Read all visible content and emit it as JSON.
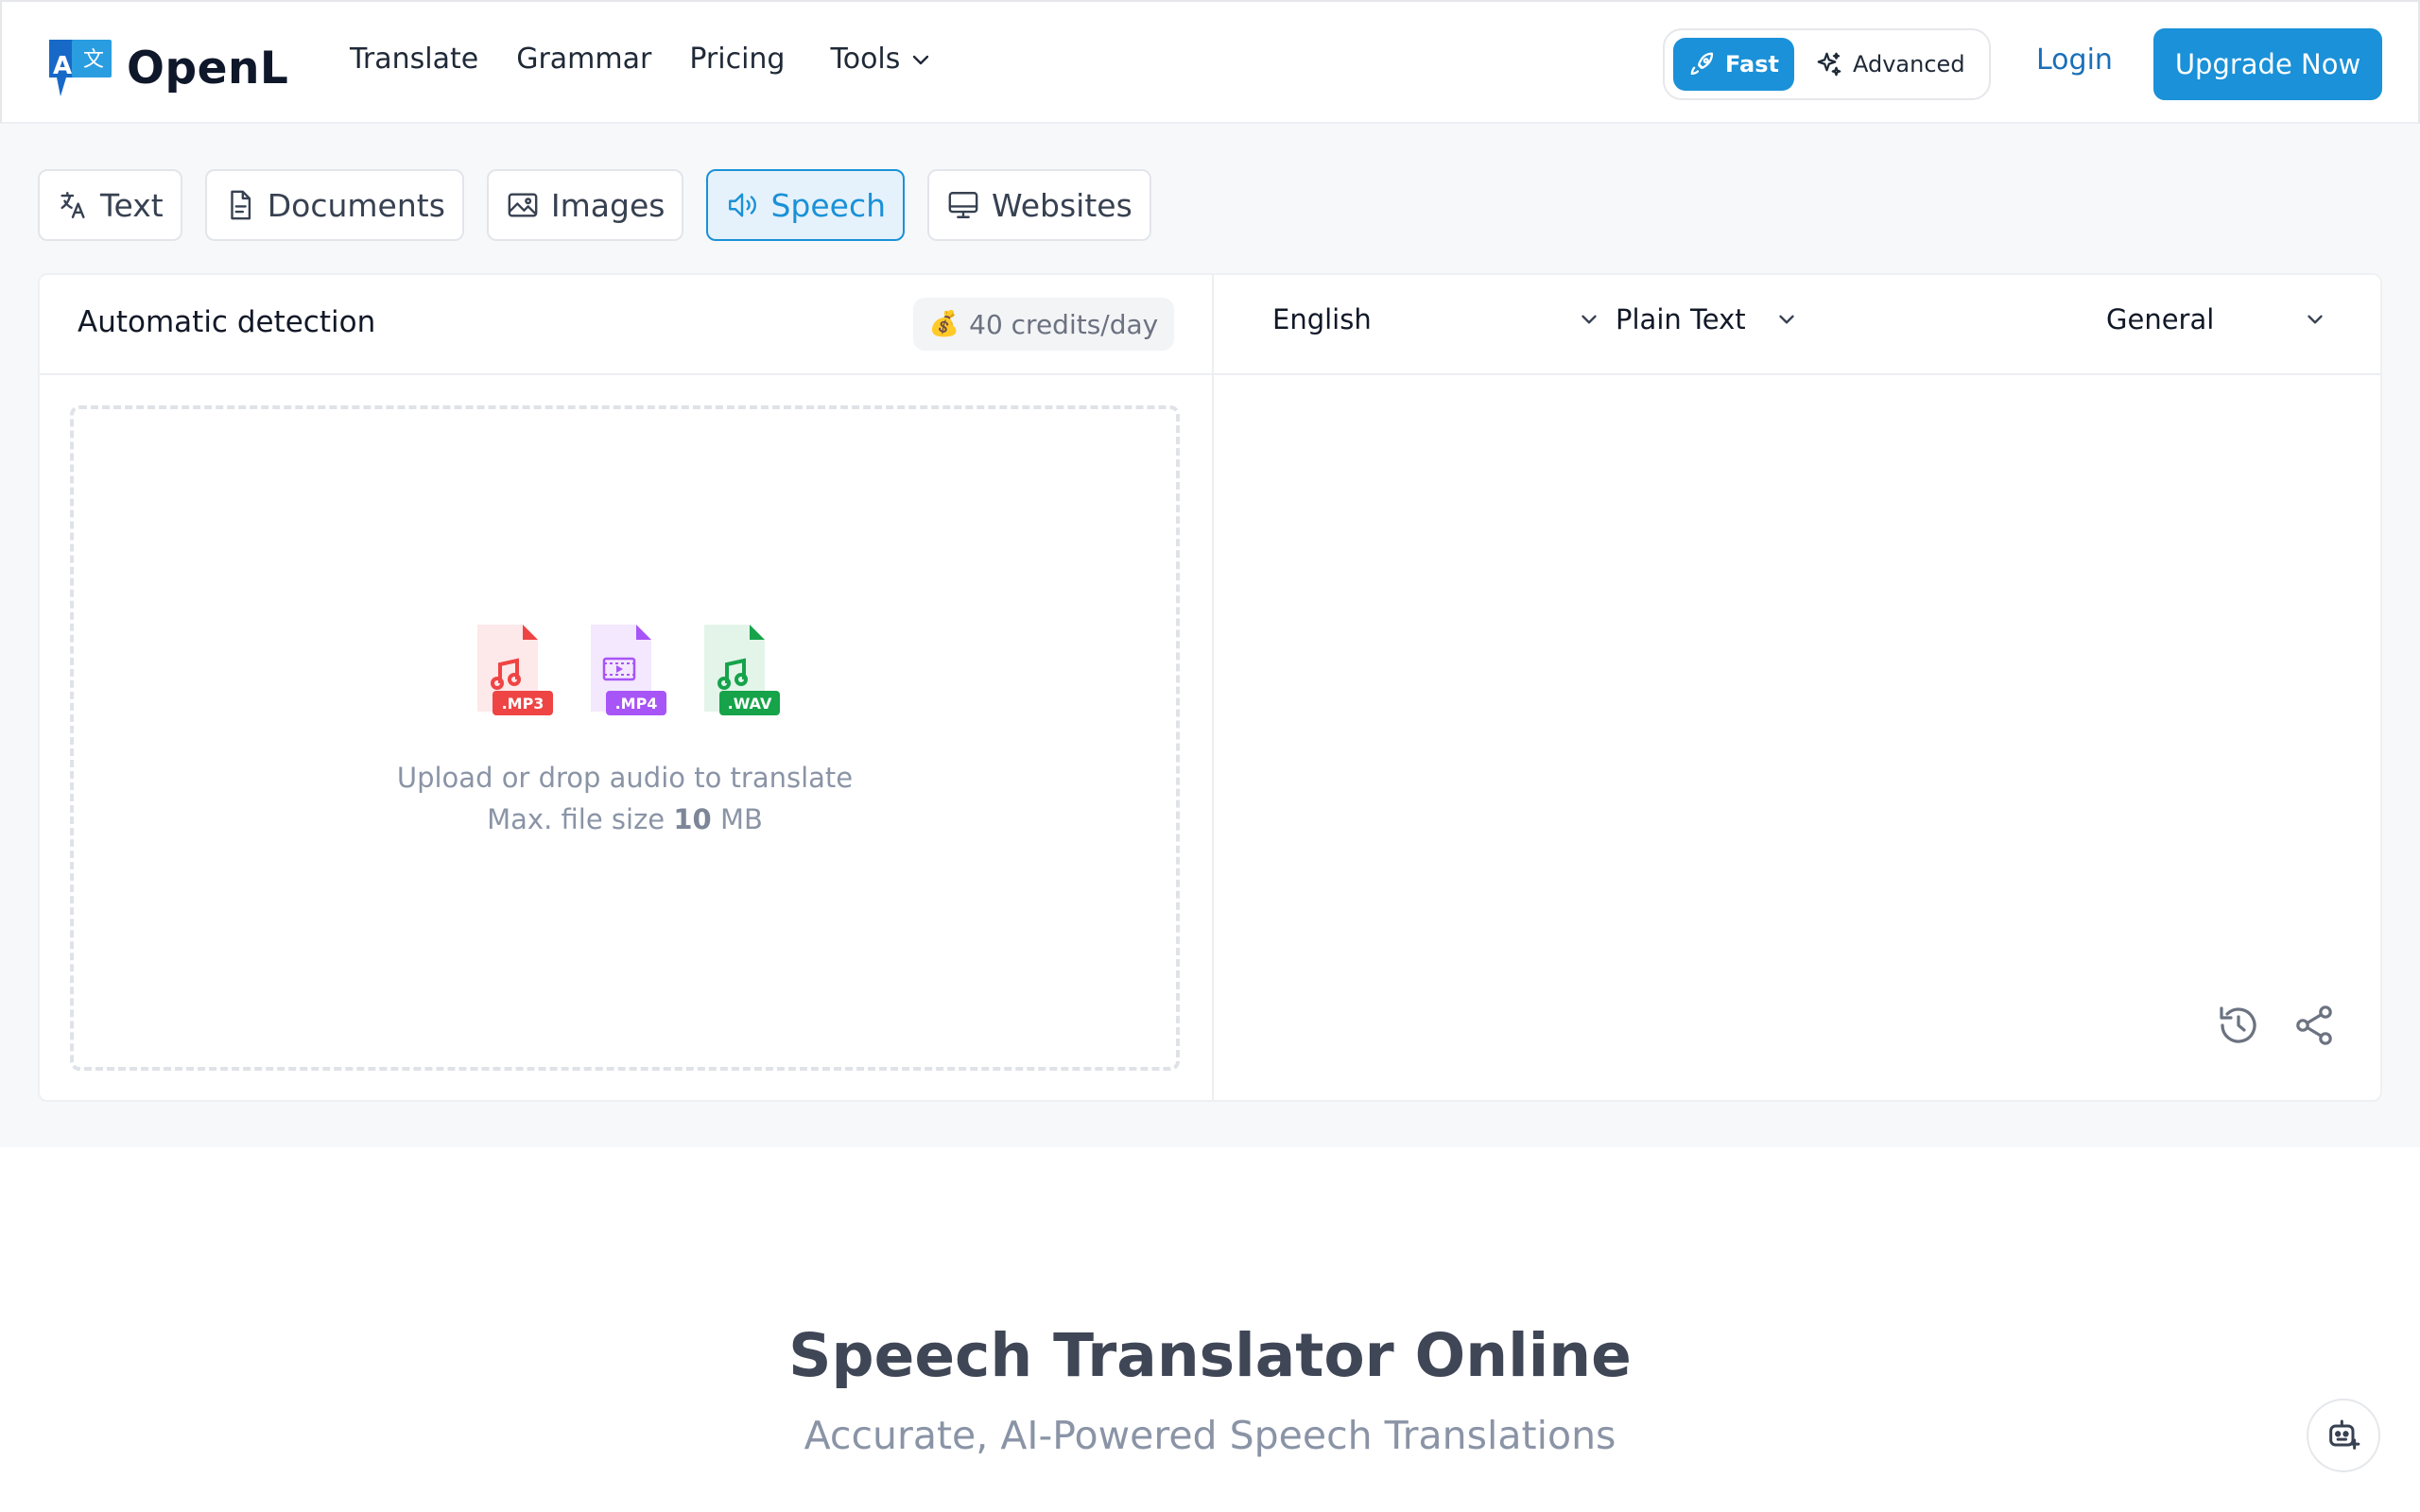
{
  "brand": {
    "name": "OpenL",
    "logo_letters": "A 文"
  },
  "nav": {
    "items": [
      "Translate",
      "Grammar",
      "Pricing"
    ],
    "tools_label": "Tools"
  },
  "mode": {
    "fast_label": "Fast",
    "advanced_label": "Advanced",
    "selected": "Fast"
  },
  "auth": {
    "login_label": "Login",
    "upgrade_label": "Upgrade Now"
  },
  "tabs": [
    {
      "label": "Text",
      "icon": "translate-icon",
      "active": false
    },
    {
      "label": "Documents",
      "icon": "document-icon",
      "active": false
    },
    {
      "label": "Images",
      "icon": "image-icon",
      "active": false
    },
    {
      "label": "Speech",
      "icon": "speaker-icon",
      "active": true
    },
    {
      "label": "Websites",
      "icon": "monitor-icon",
      "active": false
    }
  ],
  "source": {
    "language": "Automatic detection",
    "credits": "40 credits/day",
    "credits_icon": "money-bag-icon"
  },
  "target": {
    "language": "English",
    "format": "Plain Text",
    "domain": "General"
  },
  "upload": {
    "file_types": [
      ".MP3",
      ".MP4",
      ".WAV"
    ],
    "line1": "Upload or drop audio to translate",
    "size_prefix": "Max. file size",
    "size_value": "10",
    "size_unit": "MB"
  },
  "hero": {
    "title": "Speech Translator Online",
    "subtitle": "Accurate, AI-Powered Speech Translations"
  },
  "colors": {
    "accent": "#1a91d8",
    "mp3": "#ef4444",
    "mp4": "#a855f7",
    "wav": "#16a34a"
  }
}
